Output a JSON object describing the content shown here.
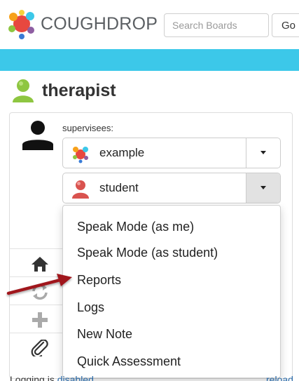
{
  "header": {
    "brand": "COUGHDROP",
    "search_placeholder": "Search Boards",
    "go_label": "Go"
  },
  "user": {
    "name": "therapist"
  },
  "supervisees": {
    "label": "supervisees:",
    "items": [
      {
        "name": "example",
        "avatar": "coughdrop-logo-icon"
      },
      {
        "name": "student",
        "avatar": "person-red-icon"
      }
    ]
  },
  "sidebar_icons": [
    "home-icon",
    "sync-icon",
    "plus-icon",
    "paperclip-icon"
  ],
  "dropdown_menu": {
    "items": [
      "Speak Mode (as me)",
      "Speak Mode (as student)",
      "Reports",
      "Logs",
      "New Note",
      "Quick Assessment"
    ]
  },
  "footer": {
    "text": "Logging is",
    "link": "disabled",
    "reload": "reload"
  },
  "colors": {
    "brand_blue": "#3cc8e9",
    "annotation_arrow": "#a0151e",
    "avatar_green": "#8ec641",
    "avatar_red": "#d9534f"
  }
}
